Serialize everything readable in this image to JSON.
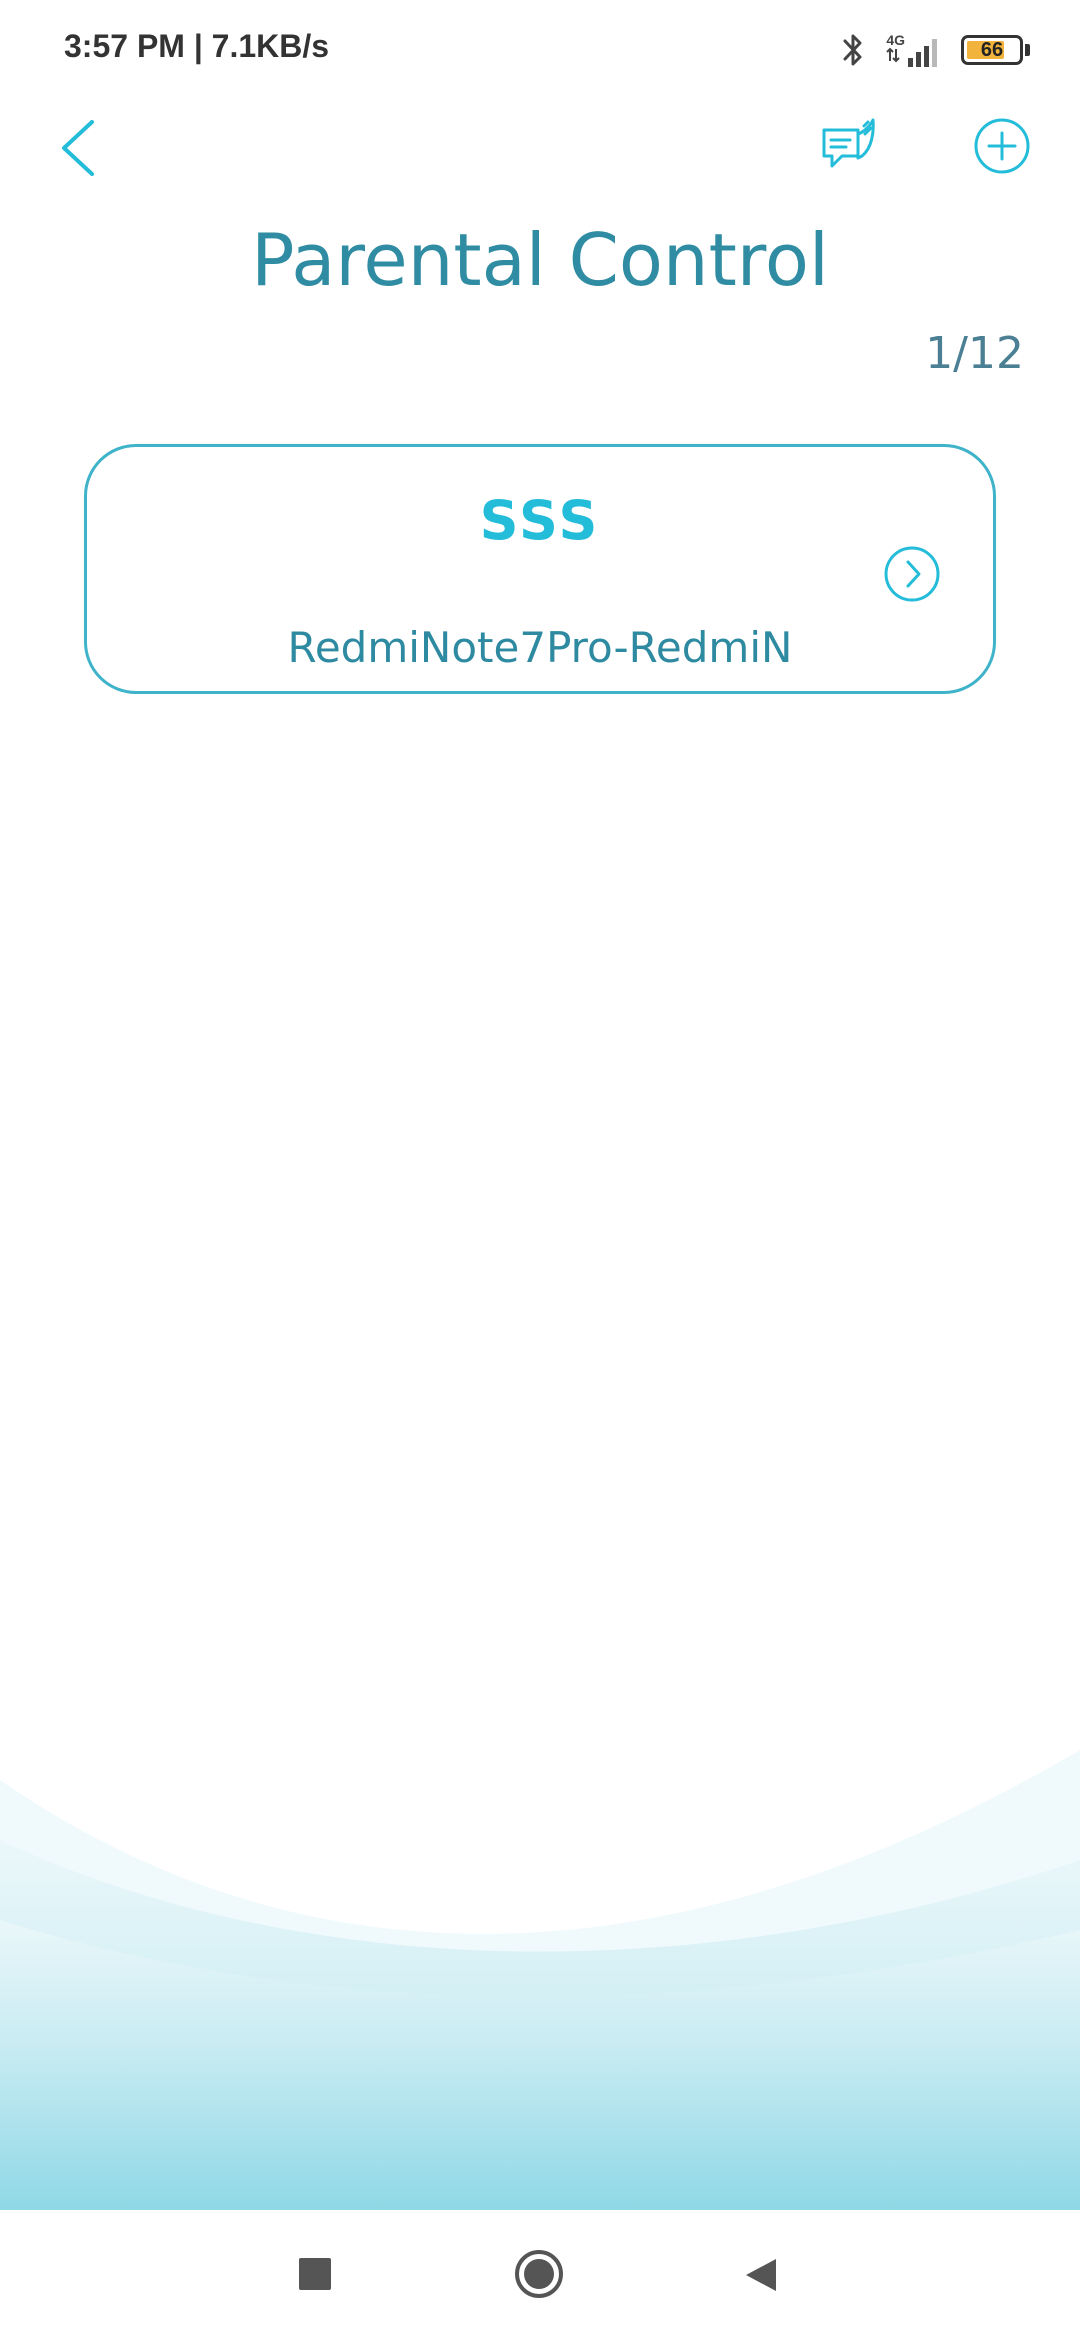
{
  "status_bar": {
    "time_speed": "3:57 PM | 7.1KB/s",
    "network": "4G",
    "battery": "66"
  },
  "header": {
    "title": "Parental Control",
    "page_counter": "1/12"
  },
  "profiles": [
    {
      "name": "SSS",
      "device": "RedmiNote7Pro-RedmiN"
    }
  ],
  "icons": {
    "back": "chevron-left-icon",
    "feedback": "feedback-icon",
    "add": "plus-circle-icon",
    "profile_arrow": "chevron-right-circle-icon"
  },
  "colors": {
    "accent": "#23bcd9",
    "title": "#2f8ca3",
    "card_border": "#3fb3c9"
  }
}
